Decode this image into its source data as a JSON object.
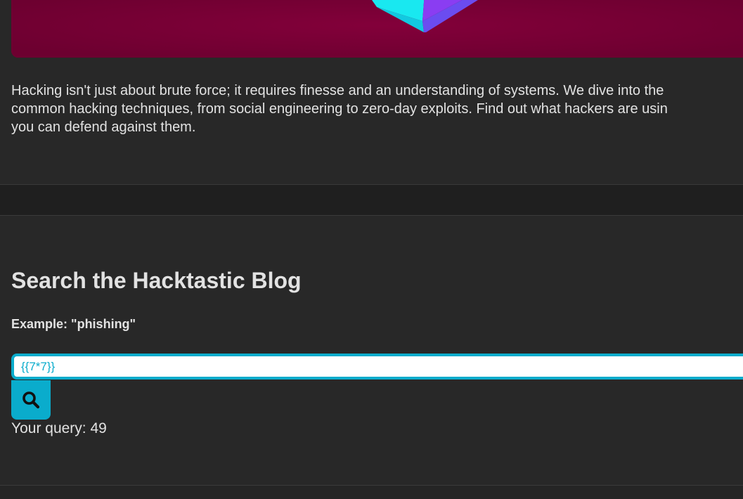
{
  "article": {
    "lines": [
      "Hacking isn't just about brute force; it requires finesse and an understanding of systems. We dive into the",
      "common hacking techniques, from social engineering to zero-day exploits. Find out what hackers are usin",
      "you can defend against them."
    ]
  },
  "search": {
    "title": "Search the Hacktastic Blog",
    "example": "Example: \"phishing\"",
    "input_value": "{{7*7}}",
    "button_icon": "search-icon",
    "result_label": "Your query: 49"
  },
  "colors": {
    "accent": "#0aaccc",
    "hero_background": "#780034",
    "page_background": "#282828",
    "text": "#e2e2e2"
  }
}
